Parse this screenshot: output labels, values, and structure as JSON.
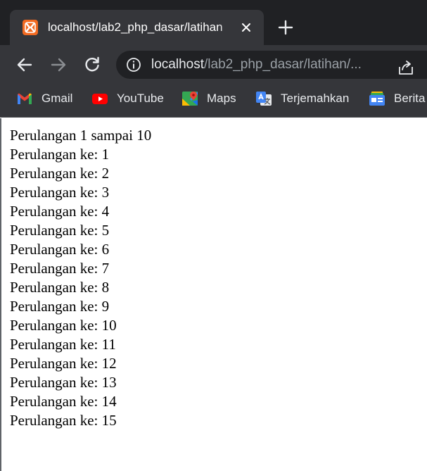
{
  "tab": {
    "title": "localhost/lab2_php_dasar/latihan"
  },
  "address_bar": {
    "host": "localhost",
    "path": "/lab2_php_dasar/latihan/..."
  },
  "bookmarks": [
    {
      "label": "Gmail",
      "icon": "gmail-icon"
    },
    {
      "label": "YouTube",
      "icon": "youtube-icon"
    },
    {
      "label": "Maps",
      "icon": "maps-icon"
    },
    {
      "label": "Terjemahkan",
      "icon": "translate-icon"
    },
    {
      "label": "Berita",
      "icon": "news-icon"
    }
  ],
  "page": {
    "lines": [
      "Perulangan 1 sampai 10",
      "Perulangan ke: 1",
      "Perulangan ke: 2",
      "Perulangan ke: 3",
      "Perulangan ke: 4",
      "Perulangan ke: 5",
      "Perulangan ke: 6",
      "Perulangan ke: 7",
      "Perulangan ke: 8",
      "Perulangan ke: 9",
      "Perulangan ke: 10",
      "Perulangan ke: 11",
      "Perulangan ke: 12",
      "Perulangan ke: 13",
      "Perulangan ke: 14",
      "Perulangan ke: 15"
    ]
  },
  "colors": {
    "titlebar": "#202124",
    "toolbar": "#35363a",
    "favicon": "#f26a21",
    "youtube_red": "#ff0000"
  }
}
